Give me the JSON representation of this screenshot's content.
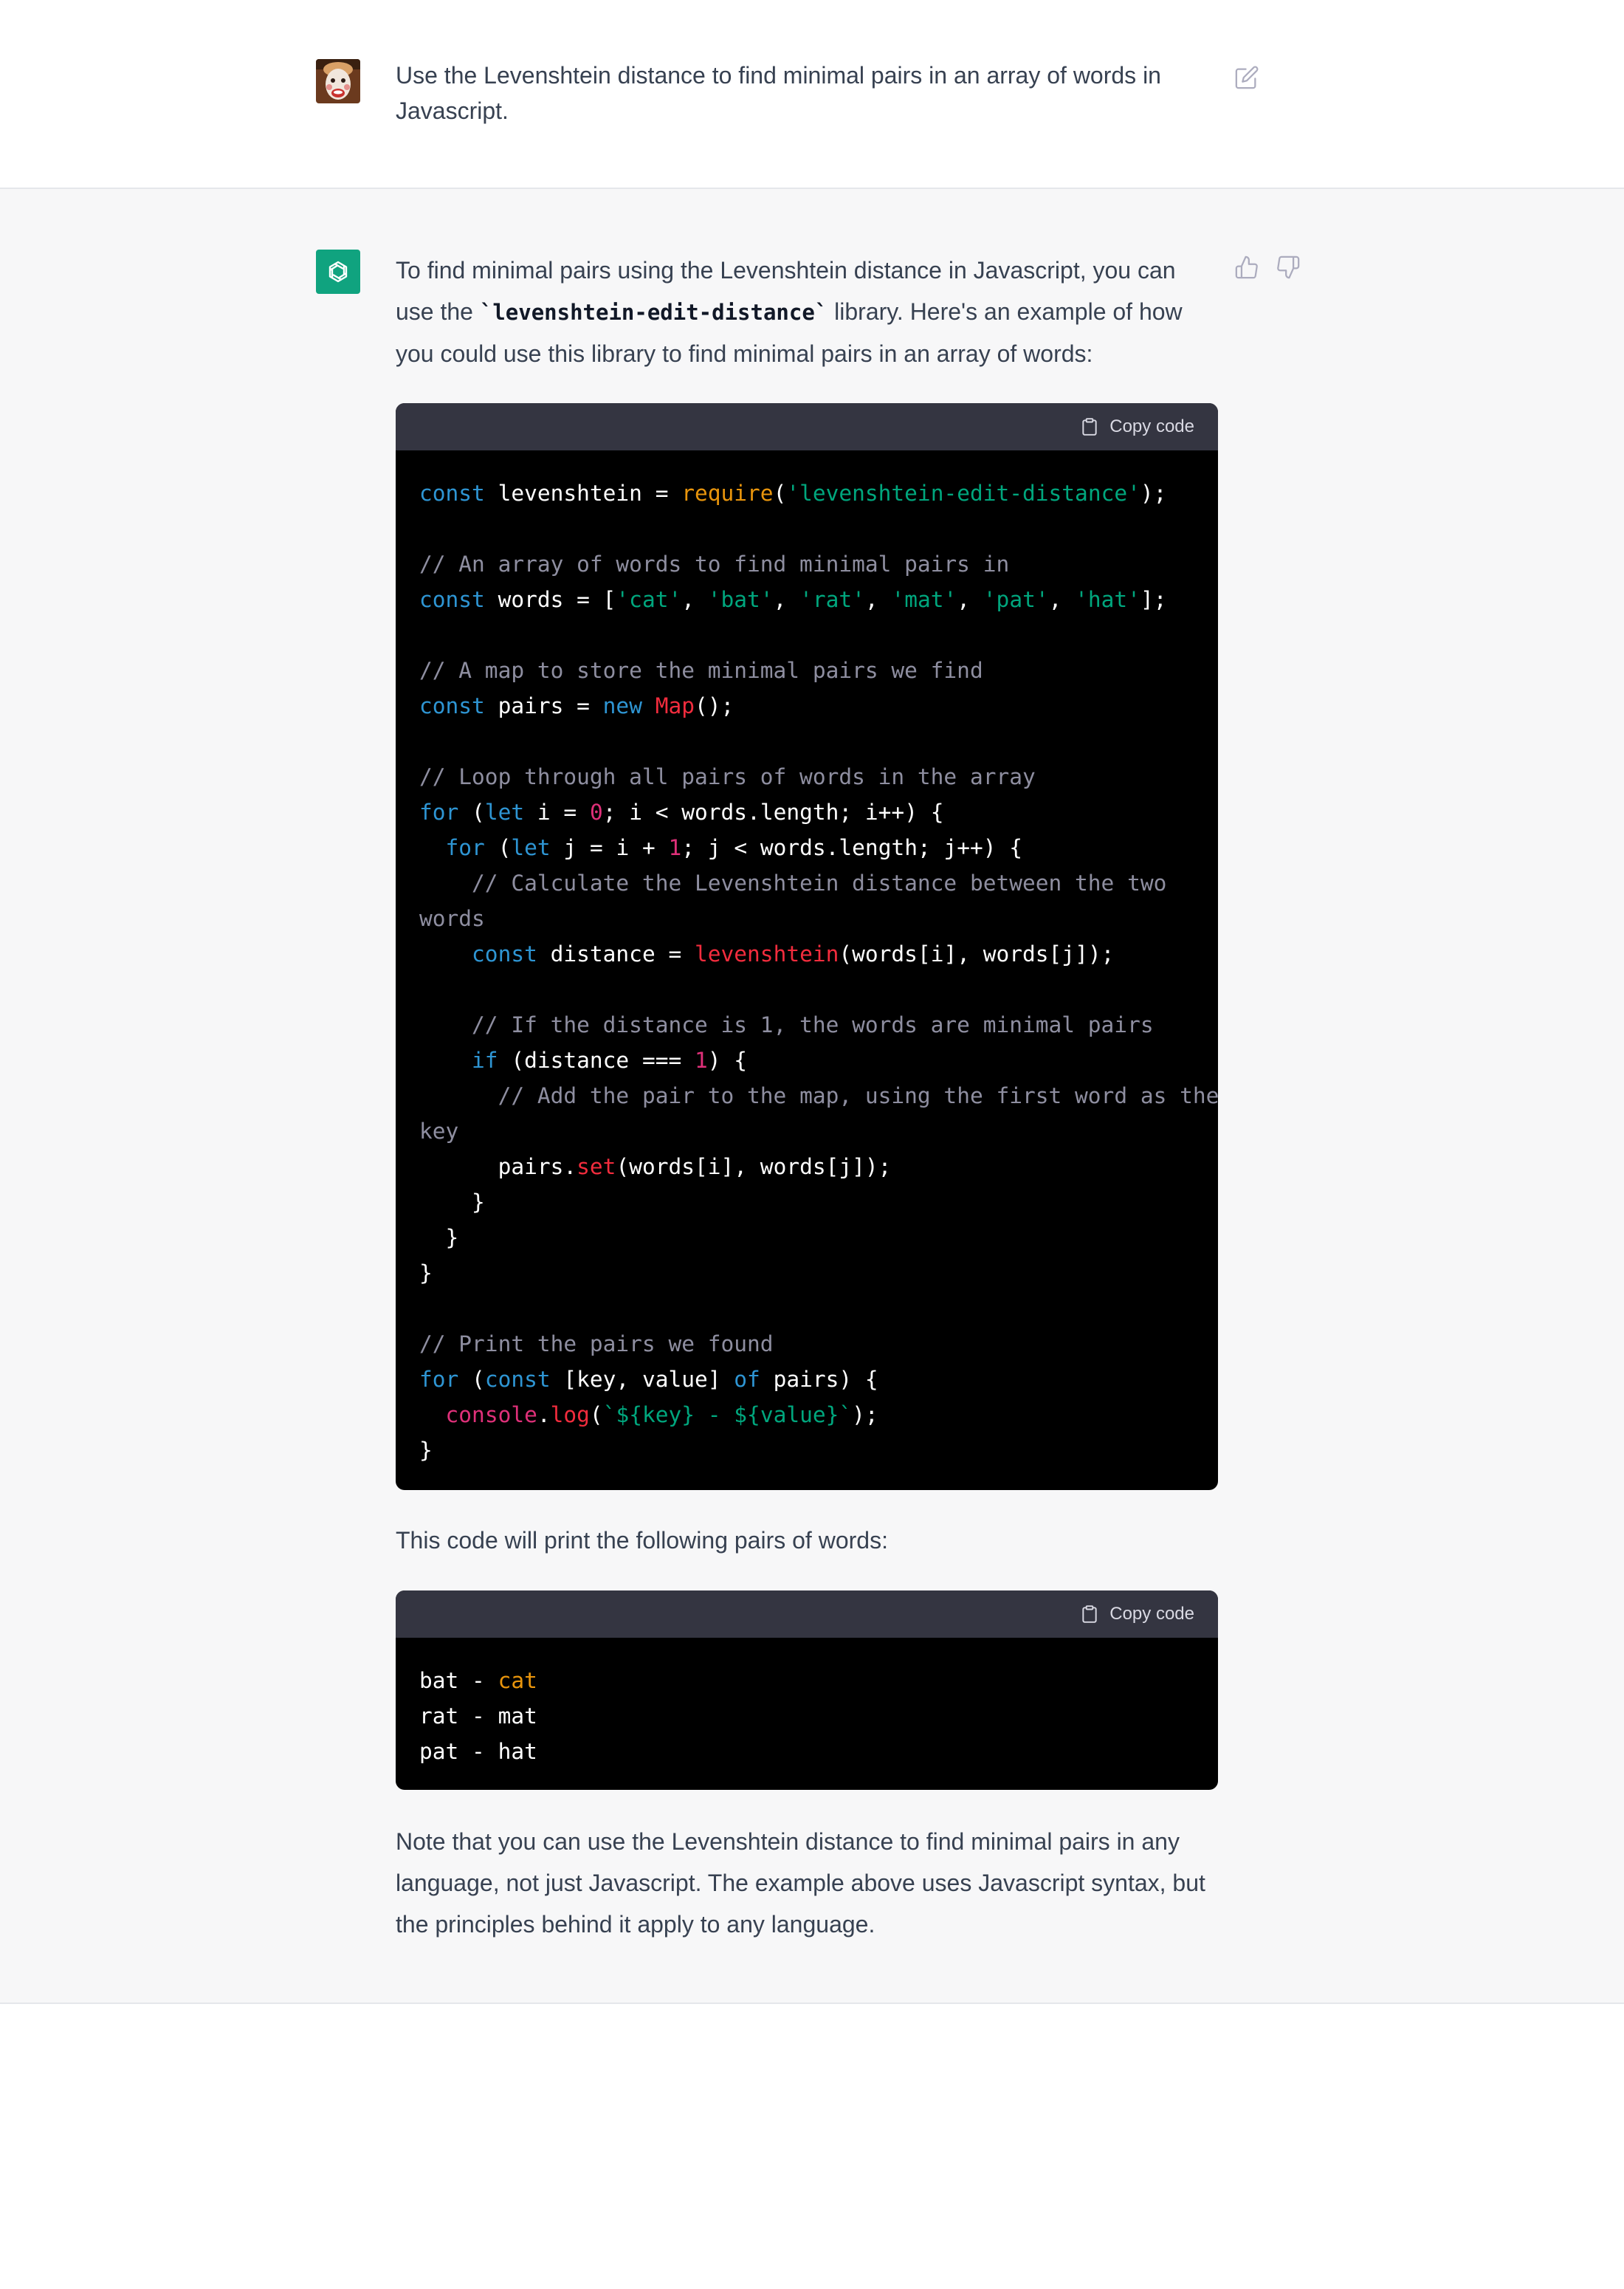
{
  "user_turn": {
    "avatar_label": "user avatar",
    "message": "Use the Levenshtein distance to find minimal pairs in an array of words in Javascript."
  },
  "assistant_turn": {
    "intro_part1": "To find minimal pairs using the Levenshtein distance in Javascript, you can use the ",
    "intro_code": "`levenshtein-edit-distance`",
    "intro_part2": " library. Here's an example of how you could use this library to find minimal pairs in an array of words:",
    "code_block_1": {
      "copy_label": "Copy code",
      "lines": [
        [
          [
            "kw",
            "const"
          ],
          [
            "p",
            " levenshtein = "
          ],
          [
            "req",
            "require"
          ],
          [
            "p",
            "("
          ],
          [
            "str",
            "'levenshtein-edit-distance'"
          ],
          [
            "p",
            ");"
          ]
        ],
        [],
        [
          [
            "cm",
            "// An array of words to find minimal pairs in"
          ]
        ],
        [
          [
            "kw",
            "const"
          ],
          [
            "p",
            " words = ["
          ],
          [
            "str",
            "'cat'"
          ],
          [
            "p",
            ", "
          ],
          [
            "str",
            "'bat'"
          ],
          [
            "p",
            ", "
          ],
          [
            "str",
            "'rat'"
          ],
          [
            "p",
            ", "
          ],
          [
            "str",
            "'mat'"
          ],
          [
            "p",
            ", "
          ],
          [
            "str",
            "'pat'"
          ],
          [
            "p",
            ", "
          ],
          [
            "str",
            "'hat'"
          ],
          [
            "p",
            "];"
          ]
        ],
        [],
        [
          [
            "cm",
            "// A map to store the minimal pairs we find"
          ]
        ],
        [
          [
            "kw",
            "const"
          ],
          [
            "p",
            " pairs = "
          ],
          [
            "kw",
            "new"
          ],
          [
            "p",
            " "
          ],
          [
            "cls",
            "Map"
          ],
          [
            "p",
            "();"
          ]
        ],
        [],
        [
          [
            "cm",
            "// Loop through all pairs of words in the array"
          ]
        ],
        [
          [
            "kw",
            "for"
          ],
          [
            "p",
            " ("
          ],
          [
            "kw",
            "let"
          ],
          [
            "p",
            " i = "
          ],
          [
            "num",
            "0"
          ],
          [
            "p",
            "; i < words.length; i++) {"
          ]
        ],
        [
          [
            "p",
            "  "
          ],
          [
            "kw",
            "for"
          ],
          [
            "p",
            " ("
          ],
          [
            "kw",
            "let"
          ],
          [
            "p",
            " j = i + "
          ],
          [
            "num",
            "1"
          ],
          [
            "p",
            "; j < words.length; j++) {"
          ]
        ],
        [
          [
            "p",
            "    "
          ],
          [
            "cm",
            "// Calculate the Levenshtein distance between the two"
          ]
        ],
        [
          [
            "cm",
            "words"
          ]
        ],
        [
          [
            "p",
            "    "
          ],
          [
            "kw",
            "const"
          ],
          [
            "p",
            " distance = "
          ],
          [
            "tok-red",
            "levenshtein"
          ],
          [
            "p",
            "(words[i], words[j]);"
          ]
        ],
        [],
        [
          [
            "p",
            "    "
          ],
          [
            "cm",
            "// If the distance is 1, the words are minimal pairs"
          ]
        ],
        [
          [
            "p",
            "    "
          ],
          [
            "kw",
            "if"
          ],
          [
            "p",
            " (distance === "
          ],
          [
            "num",
            "1"
          ],
          [
            "p",
            ") {"
          ]
        ],
        [
          [
            "p",
            "      "
          ],
          [
            "cm",
            "// Add the pair to the map, using the first word as the"
          ]
        ],
        [
          [
            "cm",
            "key"
          ]
        ],
        [
          [
            "p",
            "      pairs."
          ],
          [
            "tok-red",
            "set"
          ],
          [
            "p",
            "(words[i], words[j]);"
          ]
        ],
        [
          [
            "p",
            "    }"
          ]
        ],
        [
          [
            "p",
            "  }"
          ]
        ],
        [
          [
            "p",
            "}"
          ]
        ],
        [],
        [
          [
            "cm",
            "// Print the pairs we found"
          ]
        ],
        [
          [
            "kw",
            "for"
          ],
          [
            "p",
            " ("
          ],
          [
            "kw",
            "const"
          ],
          [
            "p",
            " [key, value] "
          ],
          [
            "kw",
            "of"
          ],
          [
            "p",
            " pairs) {"
          ]
        ],
        [
          [
            "p",
            "  "
          ],
          [
            "fn",
            "console"
          ],
          [
            "p",
            "."
          ],
          [
            "tok-red",
            "log"
          ],
          [
            "p",
            "("
          ],
          [
            "str",
            "`${key} - ${value}`"
          ],
          [
            "p",
            ");"
          ]
        ],
        [
          [
            "p",
            "}"
          ]
        ]
      ]
    },
    "middle_text": "This code will print the following pairs of words:",
    "code_block_2": {
      "copy_label": "Copy code",
      "lines": [
        [
          [
            "p",
            "bat - "
          ],
          [
            "req",
            "cat"
          ]
        ],
        [
          [
            "p",
            "rat - mat"
          ]
        ],
        [
          [
            "p",
            "pat - hat"
          ]
        ]
      ]
    },
    "outro": "Note that you can use the Levenshtein distance to find minimal pairs in any language, not just Javascript. The example above uses Javascript syntax, but the principles behind it apply to any language."
  },
  "icons": {
    "edit": "edit-icon",
    "thumbs_up": "thumbs-up-icon",
    "thumbs_down": "thumbs-down-icon",
    "copy": "clipboard-icon",
    "bot": "openai-logo-icon"
  },
  "colors": {
    "bot_avatar": "#10a37f",
    "code_bg": "#000000",
    "code_header_bg": "#343541",
    "keyword": "#2e95d3",
    "string": "#00a67d",
    "comment": "#8e8ea0",
    "function": "#df3079",
    "builtin": "#f22c3d",
    "require": "#e9950c"
  }
}
